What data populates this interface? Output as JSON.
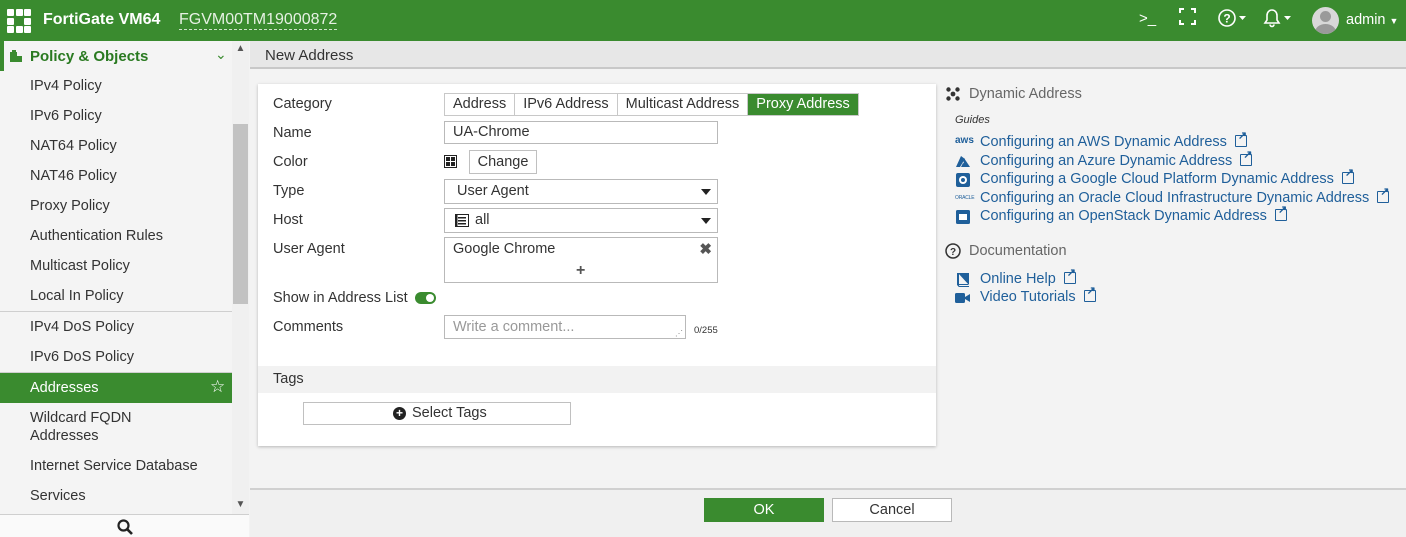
{
  "header": {
    "brand": "FortiGate VM64",
    "serial": "FGVM00TM19000872",
    "user": "admin"
  },
  "sidebar": {
    "section_title": "Policy & Objects",
    "items": [
      {
        "label": "IPv4 Policy"
      },
      {
        "label": "IPv6 Policy"
      },
      {
        "label": "NAT64 Policy"
      },
      {
        "label": "NAT46 Policy"
      },
      {
        "label": "Proxy Policy"
      },
      {
        "label": "Authentication Rules"
      },
      {
        "label": "Multicast Policy"
      },
      {
        "label": "Local In Policy"
      },
      {
        "label": "IPv4 DoS Policy"
      },
      {
        "label": "IPv6 DoS Policy"
      },
      {
        "label": "Addresses"
      },
      {
        "label": "Wildcard FQDN\nAddresses"
      },
      {
        "label": "Internet Service Database"
      },
      {
        "label": "Services"
      }
    ],
    "active_item": "Addresses"
  },
  "page": {
    "title": "New Address"
  },
  "form": {
    "category_label": "Category",
    "category_options": [
      "Address",
      "IPv6 Address",
      "Multicast Address",
      "Proxy Address"
    ],
    "category_selected": "Proxy Address",
    "name_label": "Name",
    "name_value": "UA-Chrome",
    "color_label": "Color",
    "color_button": "Change",
    "type_label": "Type",
    "type_value": "User Agent",
    "host_label": "Host",
    "host_value": "all",
    "useragent_label": "User Agent",
    "useragent_value": "Google Chrome",
    "show_in_list_label": "Show in Address List",
    "show_in_list_on": true,
    "comments_label": "Comments",
    "comments_placeholder": "Write a comment...",
    "comments_counter": "0/255",
    "tags_label": "Tags",
    "select_tags_button": "Select Tags"
  },
  "info": {
    "dynamic_title": "Dynamic Address",
    "guides_label": "Guides",
    "guides": [
      {
        "label": "Configuring an AWS Dynamic Address",
        "icon": "aws-icon"
      },
      {
        "label": "Configuring an Azure Dynamic Address",
        "icon": "azure-icon"
      },
      {
        "label": "Configuring a Google Cloud Platform Dynamic Address",
        "icon": "gcp-icon"
      },
      {
        "label": "Configuring an Oracle Cloud Infrastructure Dynamic Address",
        "icon": "oracle-icon"
      },
      {
        "label": "Configuring an OpenStack Dynamic Address",
        "icon": "openstack-icon"
      }
    ],
    "doc_title": "Documentation",
    "docs": [
      {
        "label": "Online Help",
        "icon": "book-icon"
      },
      {
        "label": "Video Tutorials",
        "icon": "video-icon"
      }
    ],
    "aws_glyph": "aws",
    "oracle_glyph": "ORACLE"
  },
  "footer": {
    "ok": "OK",
    "cancel": "Cancel"
  },
  "colors": {
    "brand_green": "#3a8b2f",
    "link_blue": "#1f5f9a"
  }
}
